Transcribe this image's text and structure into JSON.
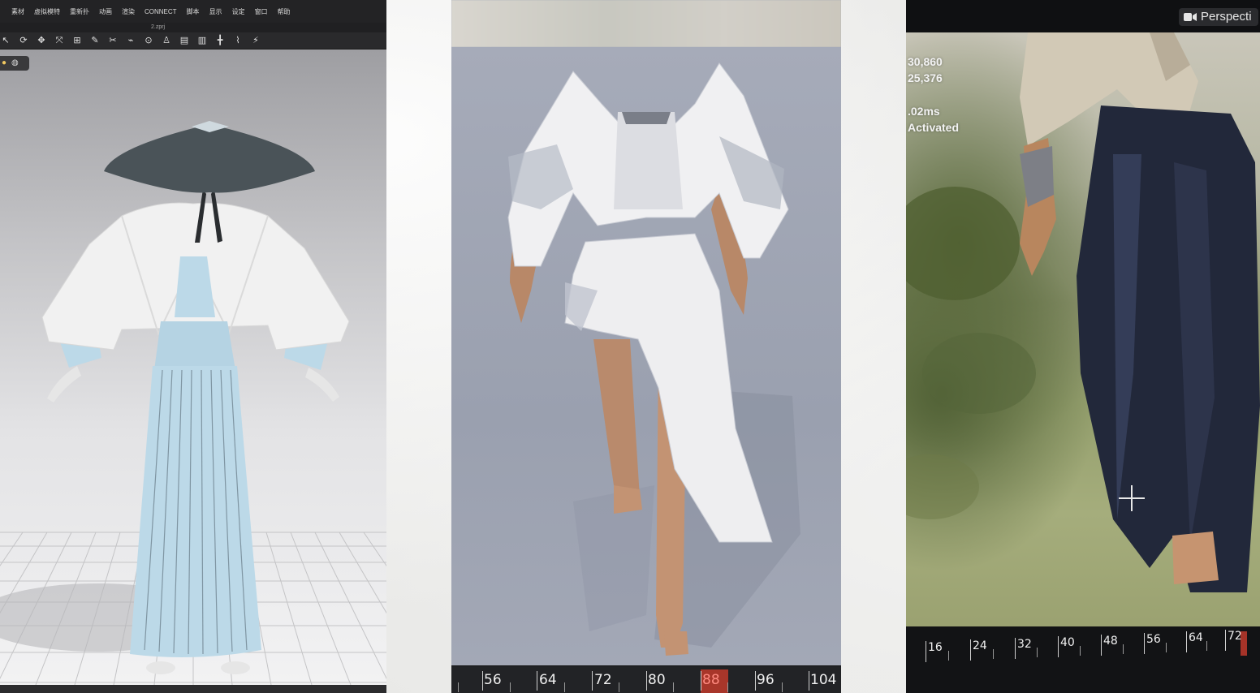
{
  "editor": {
    "menu": [
      "素材",
      "虚拟模特",
      "重新扑",
      "动画",
      "渲染",
      "CONNECT",
      "脚本",
      "显示",
      "设定",
      "窗口",
      "帮助"
    ],
    "file_title": "2.zprj",
    "toolbar_icons": [
      "select-icon",
      "rotate-icon",
      "move-icon",
      "transform-icon",
      "grid-icon",
      "edit-pattern-icon",
      "sewing-icon",
      "fold-icon",
      "pin-icon",
      "avatar-icon",
      "segment-icon",
      "layout-icon",
      "arrange-icon",
      "tack-icon",
      "simulate-icon"
    ],
    "viewport_tools": [
      "avatar-light-icon",
      "render-sphere-icon"
    ]
  },
  "cloth_sim": {
    "timeline_labels": [
      "56",
      "64",
      "72",
      "80",
      "88",
      "96",
      "104"
    ],
    "current_frame": "88"
  },
  "ar_capture": {
    "view_mode": "Perspecti",
    "stats": [
      "30,860",
      "25,376",
      "",
      ".02ms",
      "Activated"
    ],
    "timeline_labels": [
      "16",
      "24",
      "32",
      "40",
      "48",
      "56",
      "64",
      "72"
    ],
    "current_frame": "72"
  },
  "colors": {
    "garment_blue": "#bcd9e8",
    "garment_white": "#f1f1f1",
    "hat_dark": "#4a5358",
    "hakama_dark": "#22283a",
    "timeline_marker": "#c0392b"
  }
}
